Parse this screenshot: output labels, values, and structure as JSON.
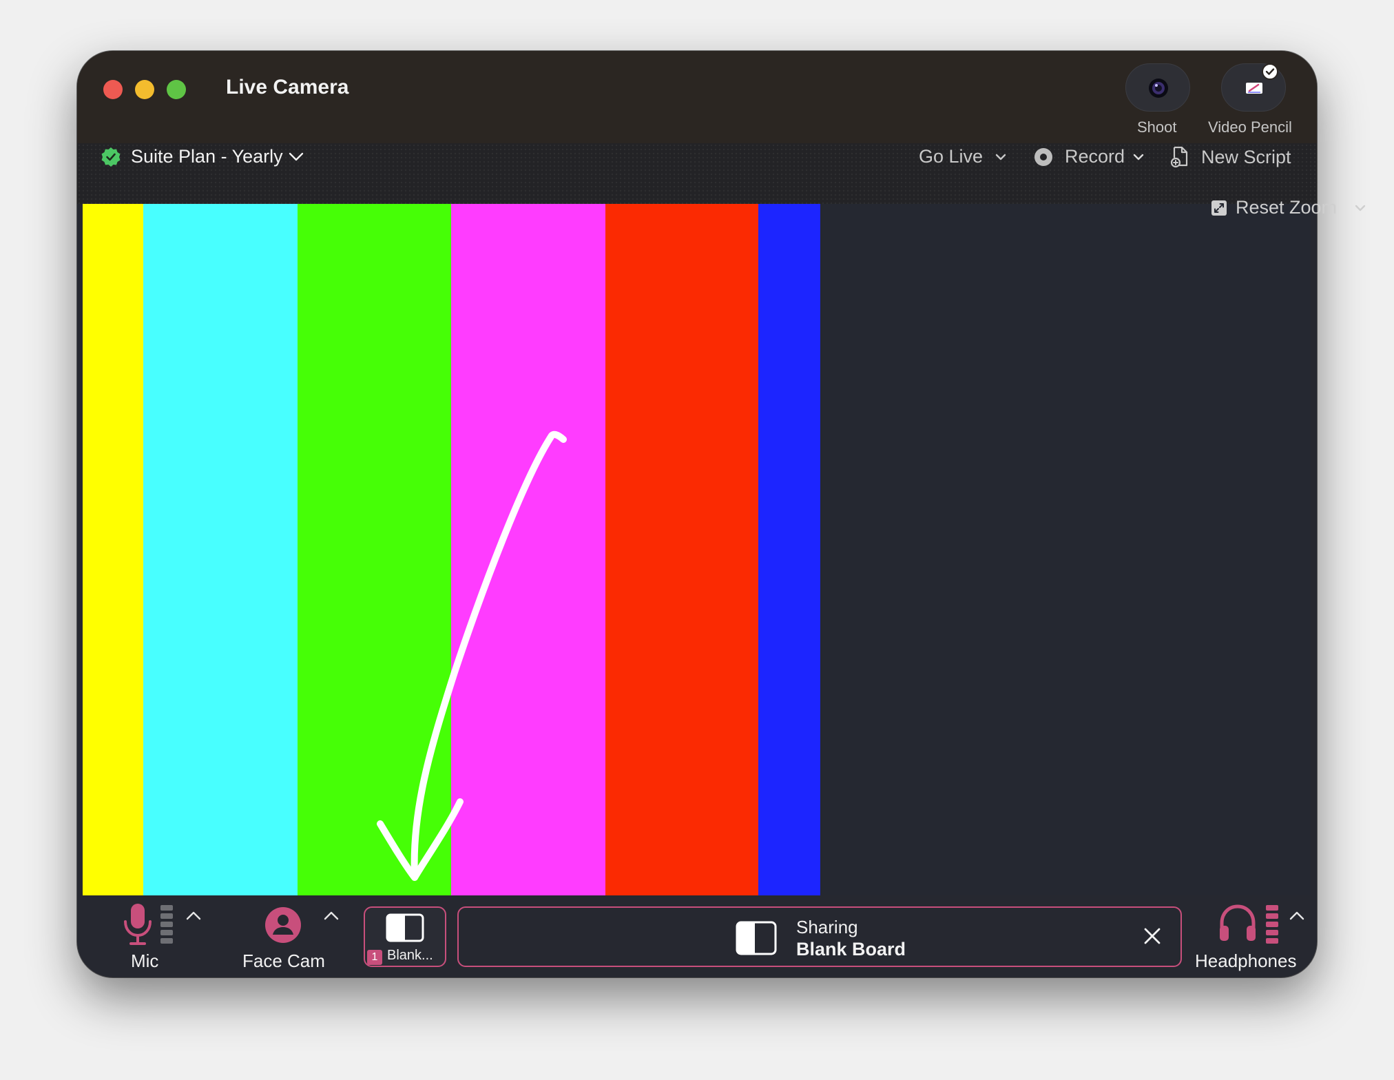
{
  "window": {
    "title": "Live Camera"
  },
  "top_actions": {
    "shoot_label": "Shoot",
    "video_pencil_label": "Video Pencil"
  },
  "toolbar": {
    "plan_label": "Suite Plan - Yearly",
    "go_live_label": "Go Live",
    "record_label": "Record",
    "new_script_label": "New Script",
    "reset_zoom_label": "Reset Zoom"
  },
  "canvas": {
    "color_bars": [
      "#ffff00",
      "#48ffff",
      "#46ff06",
      "#ff3cff",
      "#fb2a02",
      "#1c25ff"
    ],
    "annotation": "hand-drawn-arrow-down"
  },
  "bottom": {
    "mic_label": "Mic",
    "face_cam_label": "Face Cam",
    "blank_tile_number": "1",
    "blank_tile_label": "Blank...",
    "sharing_title": "Sharing",
    "sharing_target": "Blank Board",
    "headphones_label": "Headphones"
  },
  "colors": {
    "accent_pink": "#c84f7c",
    "plan_check_green": "#4cc764"
  }
}
